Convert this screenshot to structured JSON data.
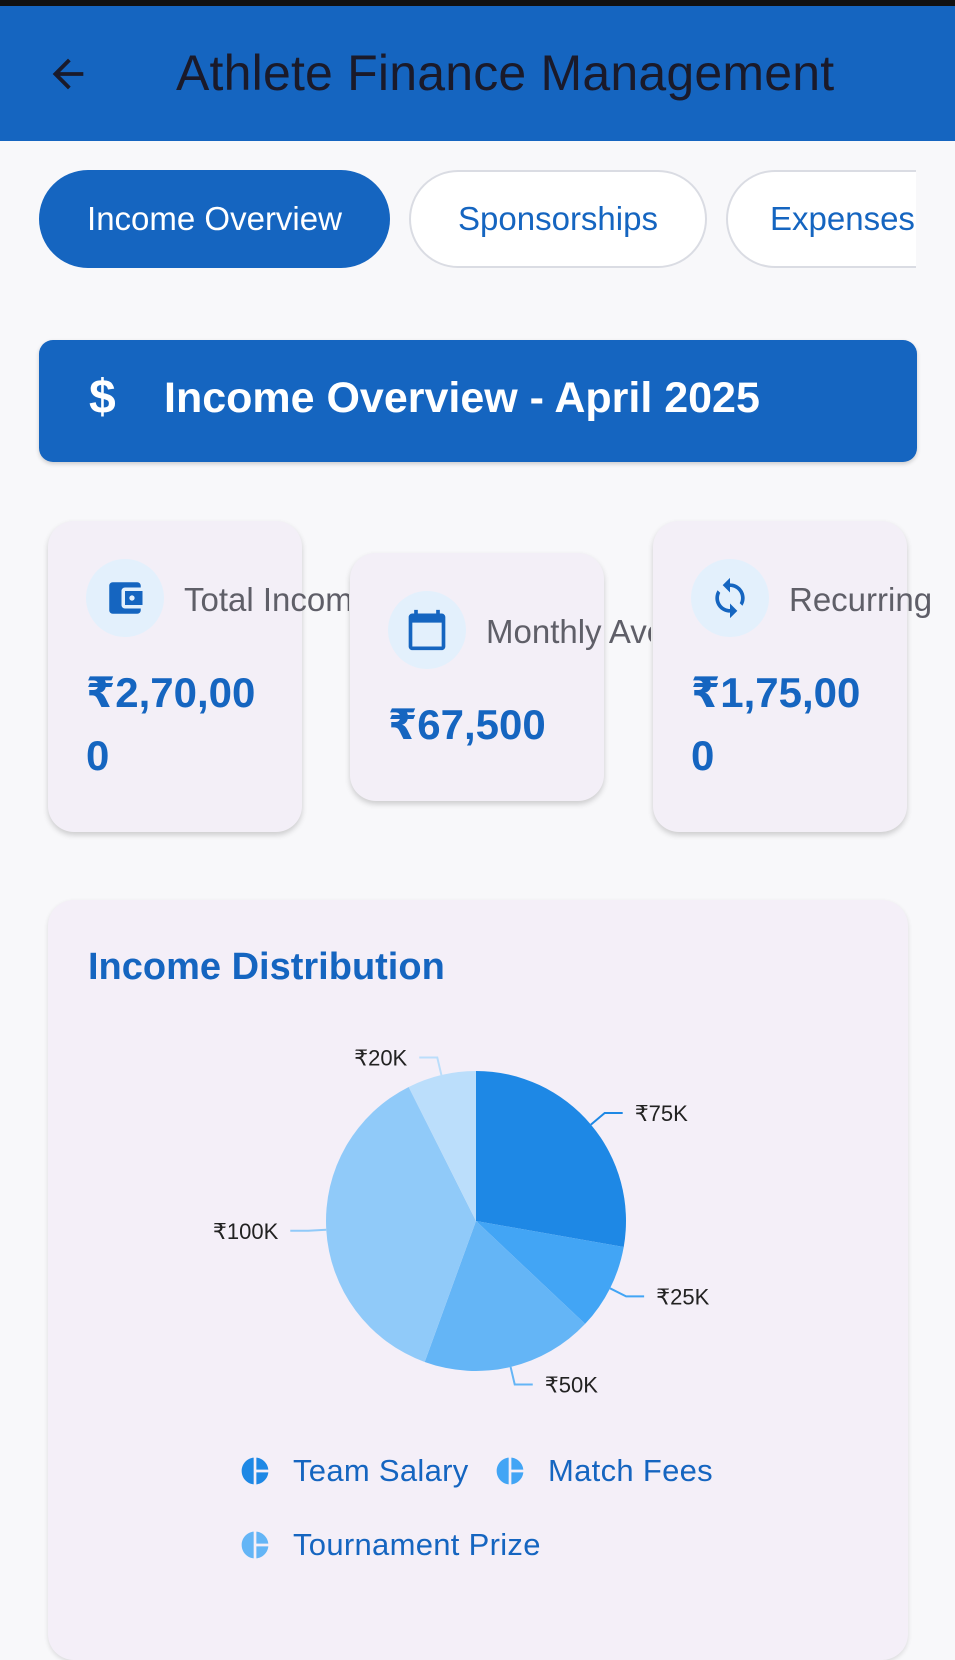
{
  "app": {
    "title": "Athlete Finance Management",
    "colors": {
      "primary": "#1565c0",
      "card_bg": "#f3eff7",
      "icon_bg": "#e3f0fc"
    }
  },
  "tabs": [
    {
      "label": "Income Overview",
      "active": true
    },
    {
      "label": "Sponsorships",
      "active": false
    },
    {
      "label": "Expenses",
      "active": false
    }
  ],
  "banner": {
    "icon": "dollar-icon",
    "title": "Income Overview - April 2025"
  },
  "stats": [
    {
      "icon": "wallet-icon",
      "label": "Total Income",
      "value": "₹2,70,000"
    },
    {
      "icon": "calendar-icon",
      "label": "Monthly Average",
      "value": "₹67,500"
    },
    {
      "icon": "sync-icon",
      "label": "Recurring",
      "value": "₹1,75,000"
    }
  ],
  "distribution": {
    "title": "Income Distribution",
    "legend": [
      {
        "label": "Team Salary",
        "icon": "pie-chart-icon"
      },
      {
        "label": "Match Fees",
        "icon": "pie-chart-icon"
      },
      {
        "label": "Tournament Prize",
        "icon": "pie-chart-icon"
      }
    ]
  },
  "chart_data": {
    "type": "pie",
    "title": "Income Distribution",
    "categories": [
      "₹75K",
      "₹25K",
      "₹50K",
      "₹100K",
      "₹20K"
    ],
    "values": [
      75,
      25,
      50,
      100,
      20
    ],
    "colors": [
      "#1e88e5",
      "#42a5f5",
      "#64b5f6",
      "#90caf9",
      "#bbdefb"
    ],
    "value_labels": [
      "₹75K",
      "₹25K",
      "₹50K",
      "₹100K",
      "₹20K"
    ]
  }
}
